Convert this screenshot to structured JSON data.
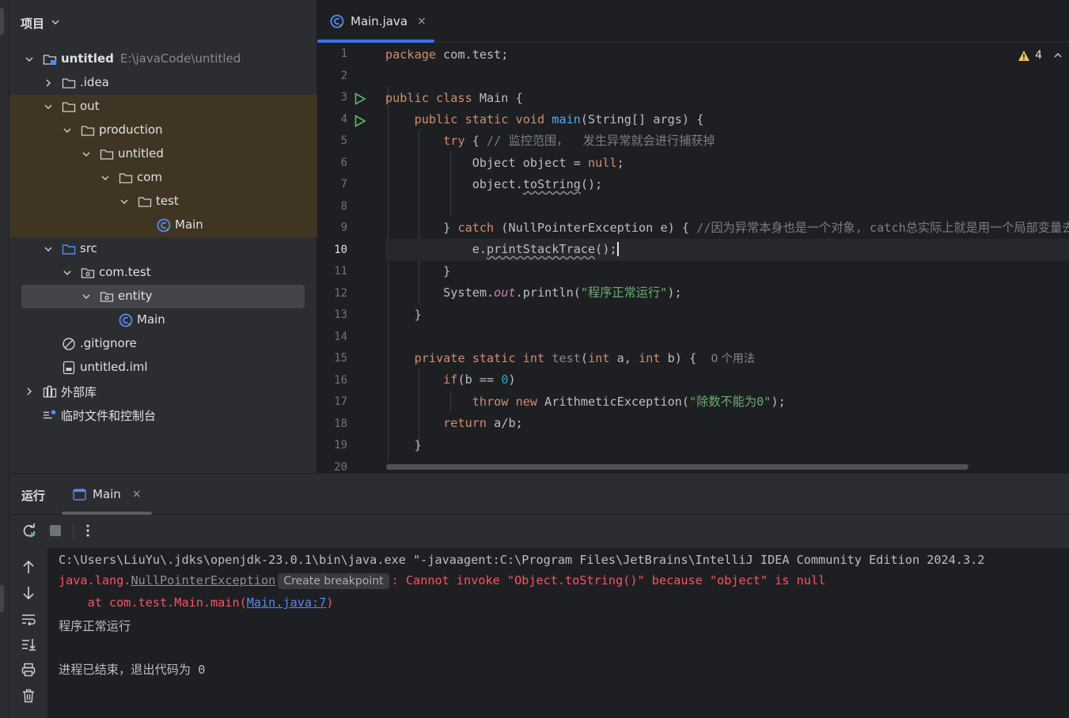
{
  "project_panel": {
    "title": "项目",
    "tree": [
      {
        "label": "untitled",
        "path": "E:\\javaCode\\untitled",
        "icon": "module-folder-icon",
        "expanded": true
      },
      {
        "label": ".idea",
        "icon": "folder-icon",
        "expanded": false
      },
      {
        "label": "out",
        "icon": "folder-icon",
        "expanded": true
      },
      {
        "label": "production",
        "icon": "folder-icon",
        "expanded": true
      },
      {
        "label": "untitled",
        "icon": "folder-icon",
        "expanded": true
      },
      {
        "label": "com",
        "icon": "folder-icon",
        "expanded": true
      },
      {
        "label": "test",
        "icon": "folder-icon",
        "expanded": true
      },
      {
        "label": "Main",
        "icon": "java-class-icon"
      },
      {
        "label": "src",
        "icon": "source-folder-icon",
        "expanded": true
      },
      {
        "label": "com.test",
        "icon": "package-icon",
        "expanded": true
      },
      {
        "label": "entity",
        "icon": "package-icon",
        "expanded": true,
        "selected": true
      },
      {
        "label": "Main",
        "icon": "java-class-icon"
      },
      {
        "label": ".gitignore",
        "icon": "ignore-file-icon"
      },
      {
        "label": "untitled.iml",
        "icon": "iml-file-icon"
      },
      {
        "label": "外部库",
        "icon": "library-icon",
        "expanded": false
      },
      {
        "label": "临时文件和控制台",
        "icon": "scratches-icon"
      }
    ]
  },
  "editor": {
    "tab": {
      "label": "Main.java",
      "close": "×"
    },
    "warnings": "4",
    "current_line": 10,
    "line_numbers": [
      "1",
      "2",
      "3",
      "4",
      "5",
      "6",
      "7",
      "8",
      "9",
      "10",
      "11",
      "12",
      "13",
      "14",
      "15",
      "16",
      "17",
      "18",
      "19",
      "20"
    ]
  },
  "run_panel": {
    "title": "运行",
    "tab": {
      "label": "Main",
      "close": "×"
    },
    "console": {
      "cmd": "C:\\Users\\LiuYu\\.jdks\\openjdk-23.0.1\\bin\\java.exe \"-javaagent:C:\\Program Files\\JetBrains\\IntelliJ IDEA Community Edition 2024.3.2",
      "exc_prefix": "java.lang.",
      "exc_name": "NullPointerException",
      "breakpoint_label": "Create breakpoint",
      "exc_message": ": Cannot invoke \"Object.toString()\" because \"object\" is null",
      "at_prefix": "    at com.test.Main.main(",
      "at_link": "Main.java:7",
      "at_suffix": ")",
      "output": "程序正常运行",
      "exit": "进程已结束，退出代码为 0"
    }
  },
  "colors": {
    "background": "#1e1f22",
    "panel": "#2b2d30",
    "accent": "#3574f0",
    "keyword": "#cf8e6d",
    "string": "#6aab73",
    "error": "#f75464",
    "link": "#548af7"
  }
}
